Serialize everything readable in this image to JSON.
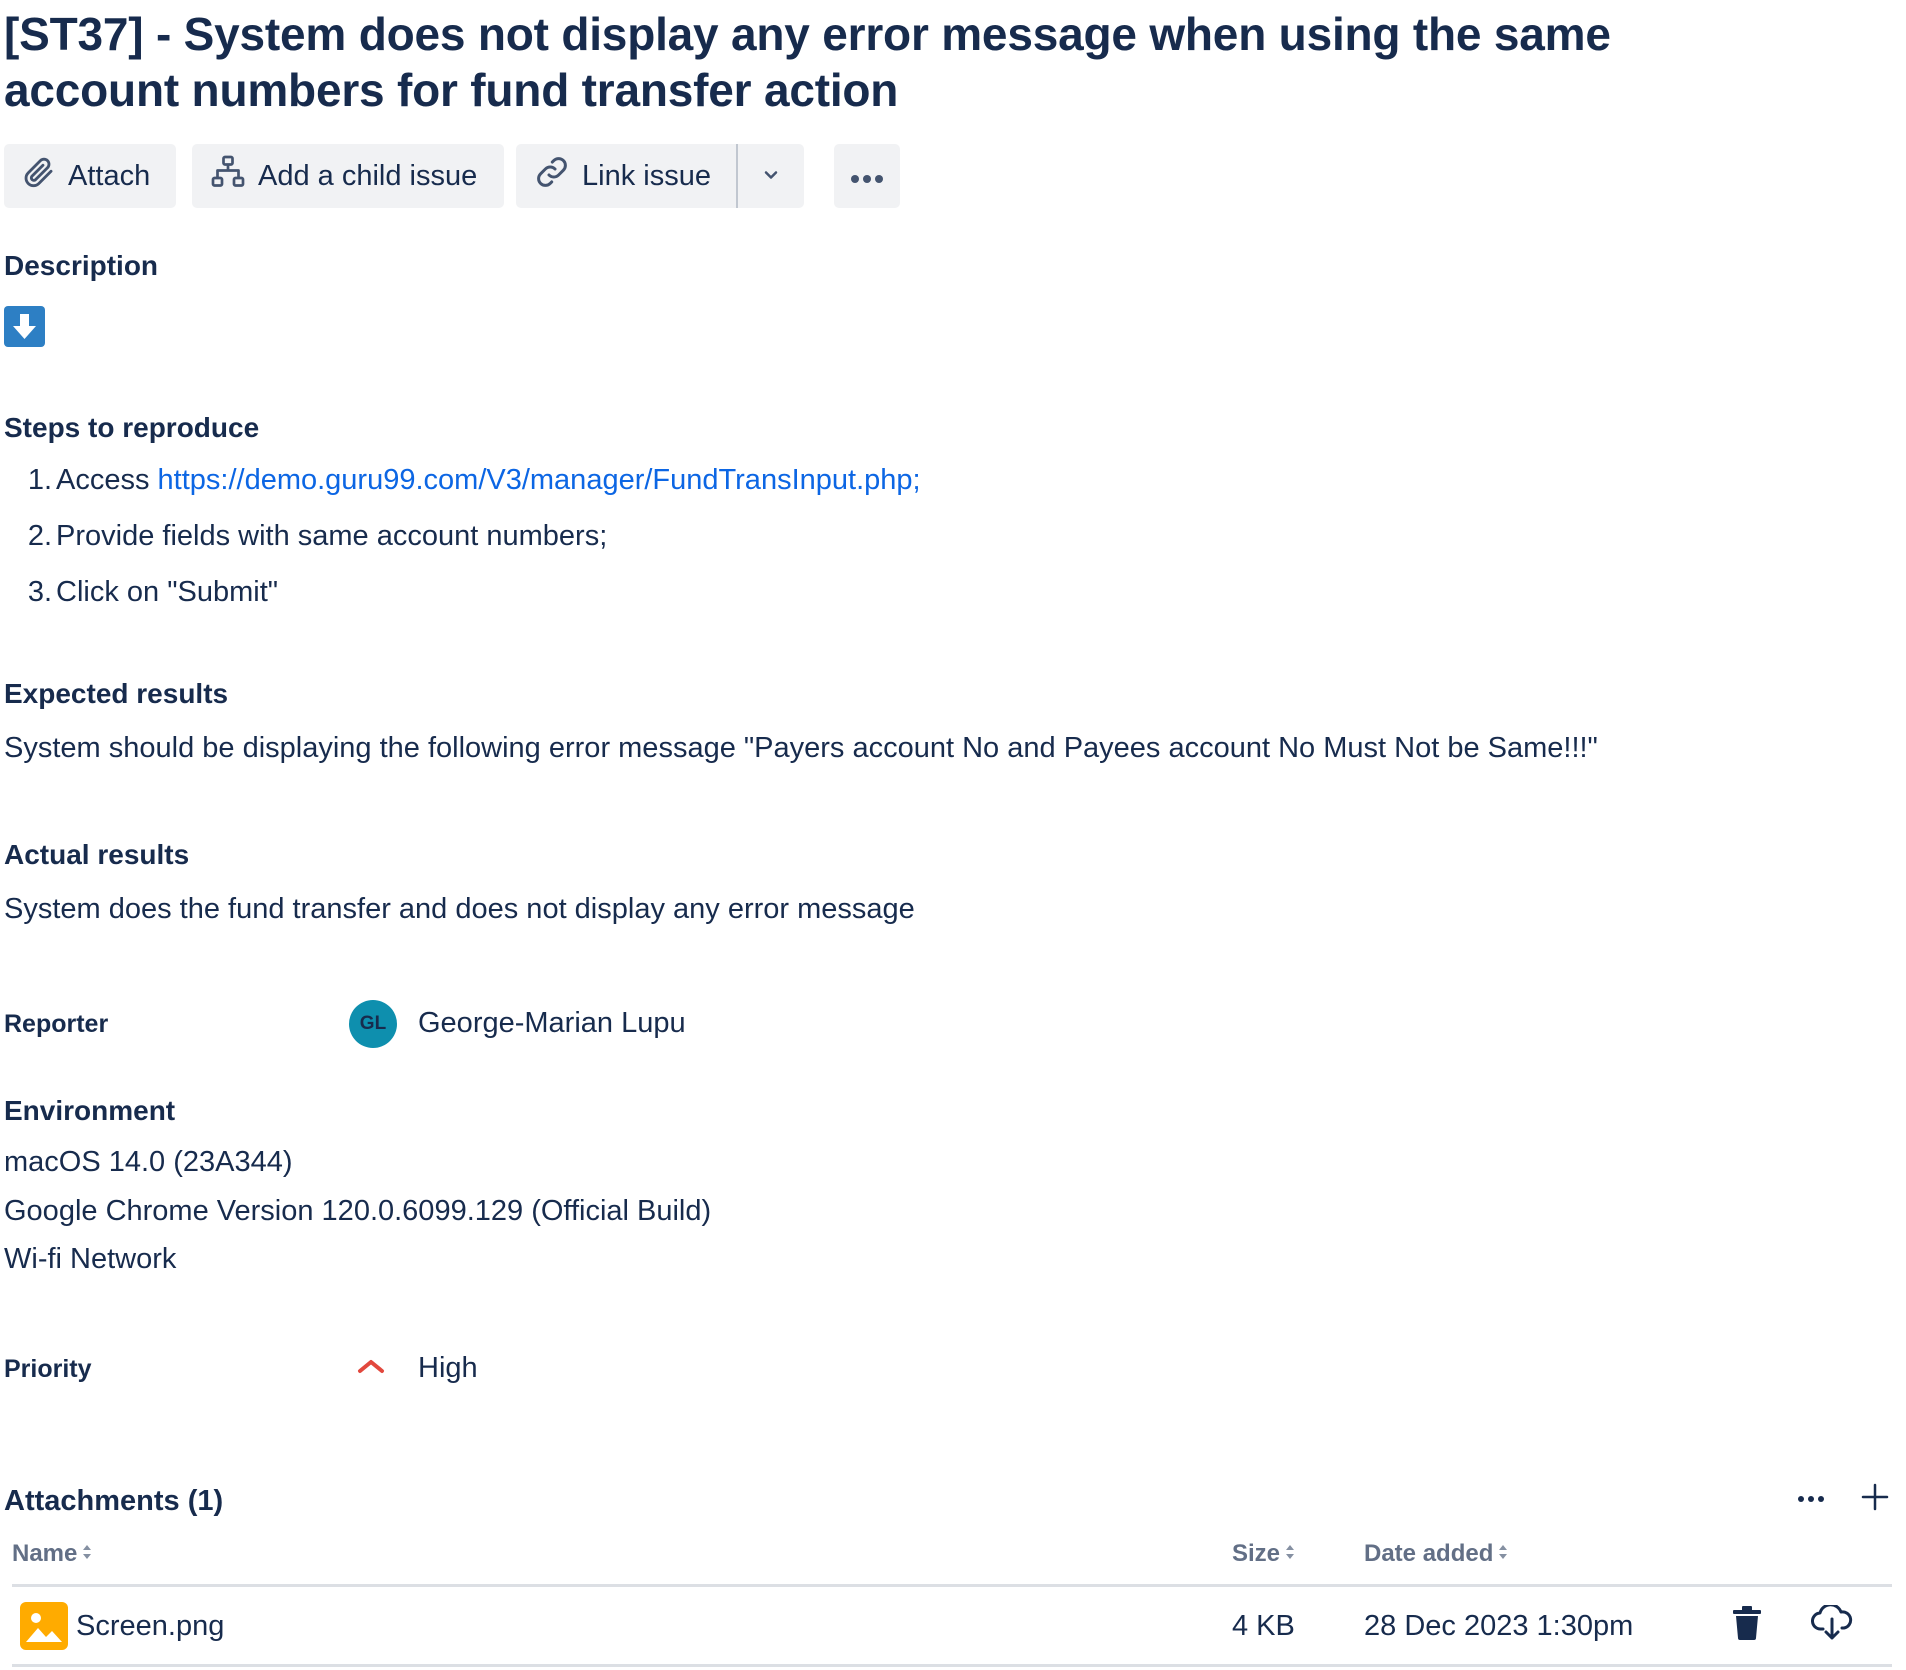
{
  "issue": {
    "title": "[ST37] - System does not display any error message when using the same account numbers for fund transfer action"
  },
  "toolbar": {
    "attach_label": "Attach",
    "add_child_label": "Add a child issue",
    "link_issue_label": "Link issue"
  },
  "description": {
    "heading": "Description",
    "steps_heading": "Steps to reproduce",
    "steps": [
      {
        "num": "1.",
        "prefix": "Access ",
        "link": "https://demo.guru99.com/V3/manager/FundTransInput.php;"
      },
      {
        "num": "2.",
        "text": "Provide fields with same account numbers;"
      },
      {
        "num": "3.",
        "text": "Click on \"Submit\""
      }
    ],
    "expected_heading": "Expected results",
    "expected_text": "System should be displaying the following error message \"Payers account No and Payees account No Must Not be Same!!!\"",
    "actual_heading": "Actual results",
    "actual_text": "System does the fund transfer and does not display any error message"
  },
  "reporter": {
    "label": "Reporter",
    "initials": "GL",
    "name": "George-Marian Lupu",
    "avatar_color": "#0e8fae"
  },
  "environment": {
    "heading": "Environment",
    "lines": [
      "macOS 14.0 (23A344)",
      "Google Chrome Version 120.0.6099.129 (Official Build)",
      "Wi-fi Network"
    ]
  },
  "priority": {
    "label": "Priority",
    "value": "High",
    "icon": "priority-high-icon",
    "color": "#e2483d"
  },
  "attachments": {
    "heading": "Attachments (1)",
    "columns": {
      "name": "Name",
      "size": "Size",
      "date": "Date added"
    },
    "files": [
      {
        "name": "Screen.png",
        "size": "4 KB",
        "date": "28 Dec 2023 1:30pm",
        "icon": "image-file-icon"
      }
    ]
  },
  "colors": {
    "text": "#172b4d",
    "link": "#0c66e4",
    "button_bg": "#f1f2f4",
    "image_icon": "#ffab00",
    "description_icon": "#2d7fc4"
  }
}
